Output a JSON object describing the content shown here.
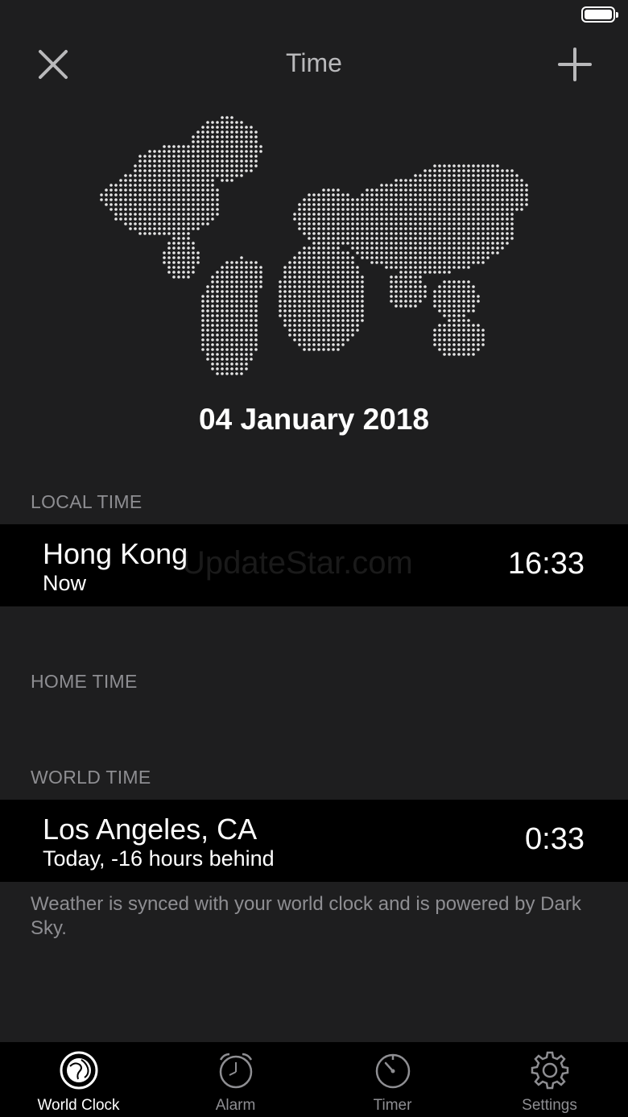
{
  "nav": {
    "title": "Time",
    "close_icon": "close-icon",
    "add_icon": "plus-icon"
  },
  "map": {
    "icon": "dotted-world-map"
  },
  "date": "04 January 2018",
  "local": {
    "header": "LOCAL TIME",
    "city": "Hong Kong",
    "subtitle": "Now",
    "time": "16:33",
    "watermark": "UpdateStar.com"
  },
  "home": {
    "header": "HOME TIME"
  },
  "world": {
    "header": "WORLD TIME",
    "city": "Los Angeles, CA",
    "subtitle": "Today, -16 hours behind",
    "time": "0:33"
  },
  "footnote": "Weather is synced with your world clock and is powered by Dark Sky.",
  "tabs": [
    {
      "label": "World Clock",
      "icon": "globe-icon",
      "active": true
    },
    {
      "label": "Alarm",
      "icon": "alarm-clock-icon",
      "active": false
    },
    {
      "label": "Timer",
      "icon": "timer-icon",
      "active": false
    },
    {
      "label": "Settings",
      "icon": "gear-icon",
      "active": false
    }
  ],
  "colors": {
    "background": "#1e1e1f",
    "row": "#000000",
    "secondary_text": "#8e8e92"
  }
}
